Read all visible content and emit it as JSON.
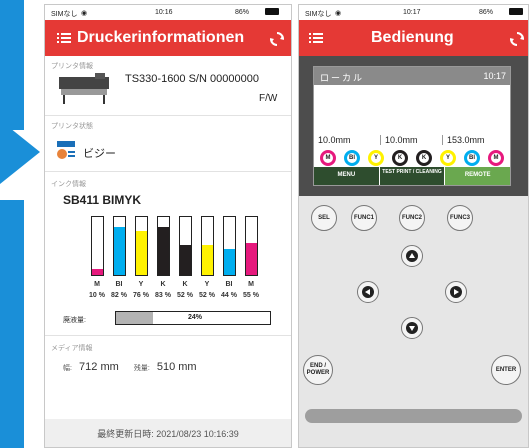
{
  "left_phone": {
    "status": {
      "carrier": "SIMなし",
      "time": "10:16",
      "battery": "86%"
    },
    "header": {
      "title": "Drucker­informationen"
    },
    "printer_info": {
      "label": "プリンタ情報",
      "model": "TS330-1600 S/N 00000000",
      "fw": "F/W"
    },
    "printer_state": {
      "label": "プリンタ状態",
      "status": "ビジー"
    },
    "ink_info": {
      "label": "インク情報",
      "ink_set": "SB411 BIMYK",
      "inks": [
        {
          "letter": "M",
          "pct": "10 %",
          "level": 0.1,
          "color": "#e6197d"
        },
        {
          "letter": "BI",
          "pct": "82 %",
          "level": 0.82,
          "color": "#00aeef"
        },
        {
          "letter": "Y",
          "pct": "76 %",
          "level": 0.76,
          "color": "#fff200"
        },
        {
          "letter": "K",
          "pct": "83 %",
          "level": 0.83,
          "color": "#231f20"
        },
        {
          "letter": "K",
          "pct": "52 %",
          "level": 0.52,
          "color": "#231f20"
        },
        {
          "letter": "Y",
          "pct": "52 %",
          "level": 0.52,
          "color": "#fff200"
        },
        {
          "letter": "BI",
          "pct": "44 %",
          "level": 0.44,
          "color": "#00aeef"
        },
        {
          "letter": "M",
          "pct": "55 %",
          "level": 0.55,
          "color": "#e6197d"
        }
      ],
      "waste_label": "廃液量:",
      "waste_pct": "24%",
      "waste_level": 0.24
    },
    "media_info": {
      "label": "メディア情報",
      "width_label": "幅:",
      "width_value": "712",
      "remain_label": "残量:",
      "remain_value": "510",
      "unit": "mm"
    },
    "footer": {
      "updated": "最終更新日時: 2021/08/23 10:16:39"
    }
  },
  "right_phone": {
    "status": {
      "carrier": "SIMなし",
      "time": "10:17",
      "battery": "86%"
    },
    "header": {
      "title": "Bedienung"
    },
    "lcd": {
      "mode": "ローカル",
      "time": "10:17",
      "values": [
        "10.0mm",
        "10.0mm",
        "153.0mm"
      ],
      "ink_labels": [
        "M",
        "Bl",
        "Y",
        "K",
        "K",
        "Y",
        "Bl",
        "M"
      ],
      "softkeys": [
        "MENU",
        "TEST PRINT / CLEANING",
        "REMOTE"
      ]
    },
    "buttons": {
      "sel": "SEL",
      "func1": "FUNC1",
      "func2": "FUNC2",
      "func3": "FUNC3",
      "end_power": "END / POWER",
      "enter": "ENTER"
    }
  },
  "colors": {
    "accent": "#e53935",
    "arrow": "#1a8fd8",
    "lcd_bg": "#4d4d4d"
  }
}
